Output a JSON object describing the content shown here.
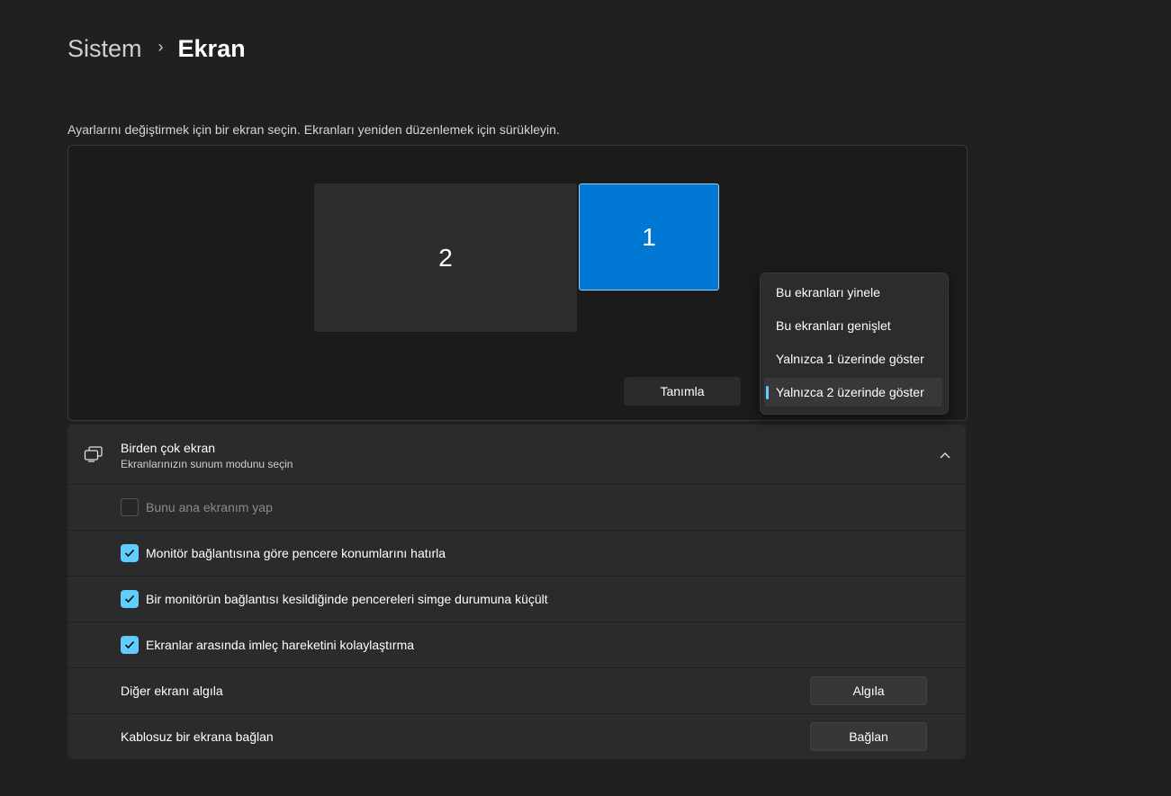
{
  "breadcrumb": {
    "parent": "Sistem",
    "separator": "›",
    "current": "Ekran"
  },
  "hint": "Ayarlarını değiştirmek için bir ekran seçin. Ekranları yeniden düzenlemek için sürükleyin.",
  "arrangement": {
    "monitors": [
      {
        "label": "2"
      },
      {
        "label": "1",
        "selected": true
      }
    ],
    "identify_label": "Tanımla"
  },
  "dropdown": {
    "items": [
      "Bu ekranları yinele",
      "Bu ekranları genişlet",
      "Yalnızca 1 üzerinde göster",
      "Yalnızca 2 üzerinde göster"
    ],
    "selected_index": 3
  },
  "multi_display": {
    "icon": "multi-monitor-icon",
    "title": "Birden çok ekran",
    "subtitle": "Ekranlarınızın sunum modunu seçin",
    "expanded": true
  },
  "options": [
    {
      "label": "Bunu ana ekranım yap",
      "checked": false,
      "disabled": true
    },
    {
      "label": "Monitör bağlantısına göre pencere konumlarını hatırla",
      "checked": true
    },
    {
      "label": "Bir monitörün bağlantısı kesildiğinde pencereleri simge durumuna küçült",
      "checked": true
    },
    {
      "label": "Ekranlar arasında imleç hareketini kolaylaştırma",
      "checked": true
    }
  ],
  "detect": {
    "label": "Diğer ekranı algıla",
    "button": "Algıla"
  },
  "wireless": {
    "label": "Kablosuz bir ekrana bağlan",
    "button": "Bağlan"
  },
  "colors": {
    "accent": "#0078d4",
    "check": "#60cdff",
    "background": "#202020",
    "card": "#2b2b2b"
  }
}
